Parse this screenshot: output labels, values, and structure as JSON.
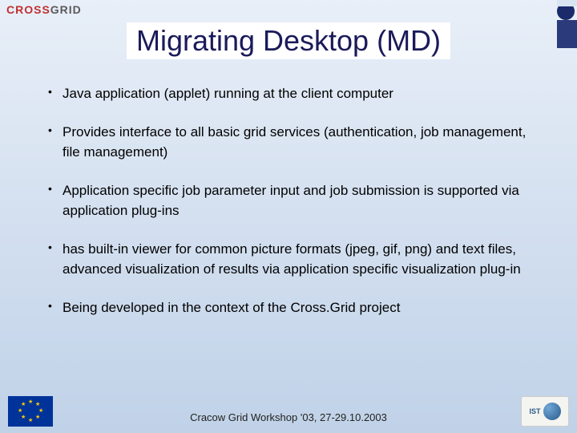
{
  "logo_text": {
    "part1": "CROSS",
    "part2": "GRID"
  },
  "title": "Migrating Desktop (MD)",
  "bullets": [
    "Java application (applet) running at the client computer",
    "Provides interface to all basic grid services (authentication, job management, file management)",
    "Application specific job parameter input and job submission is supported via application plug-ins",
    "has built-in viewer for common picture formats (jpeg, gif, png) and text files, advanced visualization of results via application specific visualization plug-in",
    "Being developed in the context of the Cross.Grid project"
  ],
  "footer": "Cracow Grid Workshop '03, 27-29.10.2003",
  "ist_label": "IST"
}
